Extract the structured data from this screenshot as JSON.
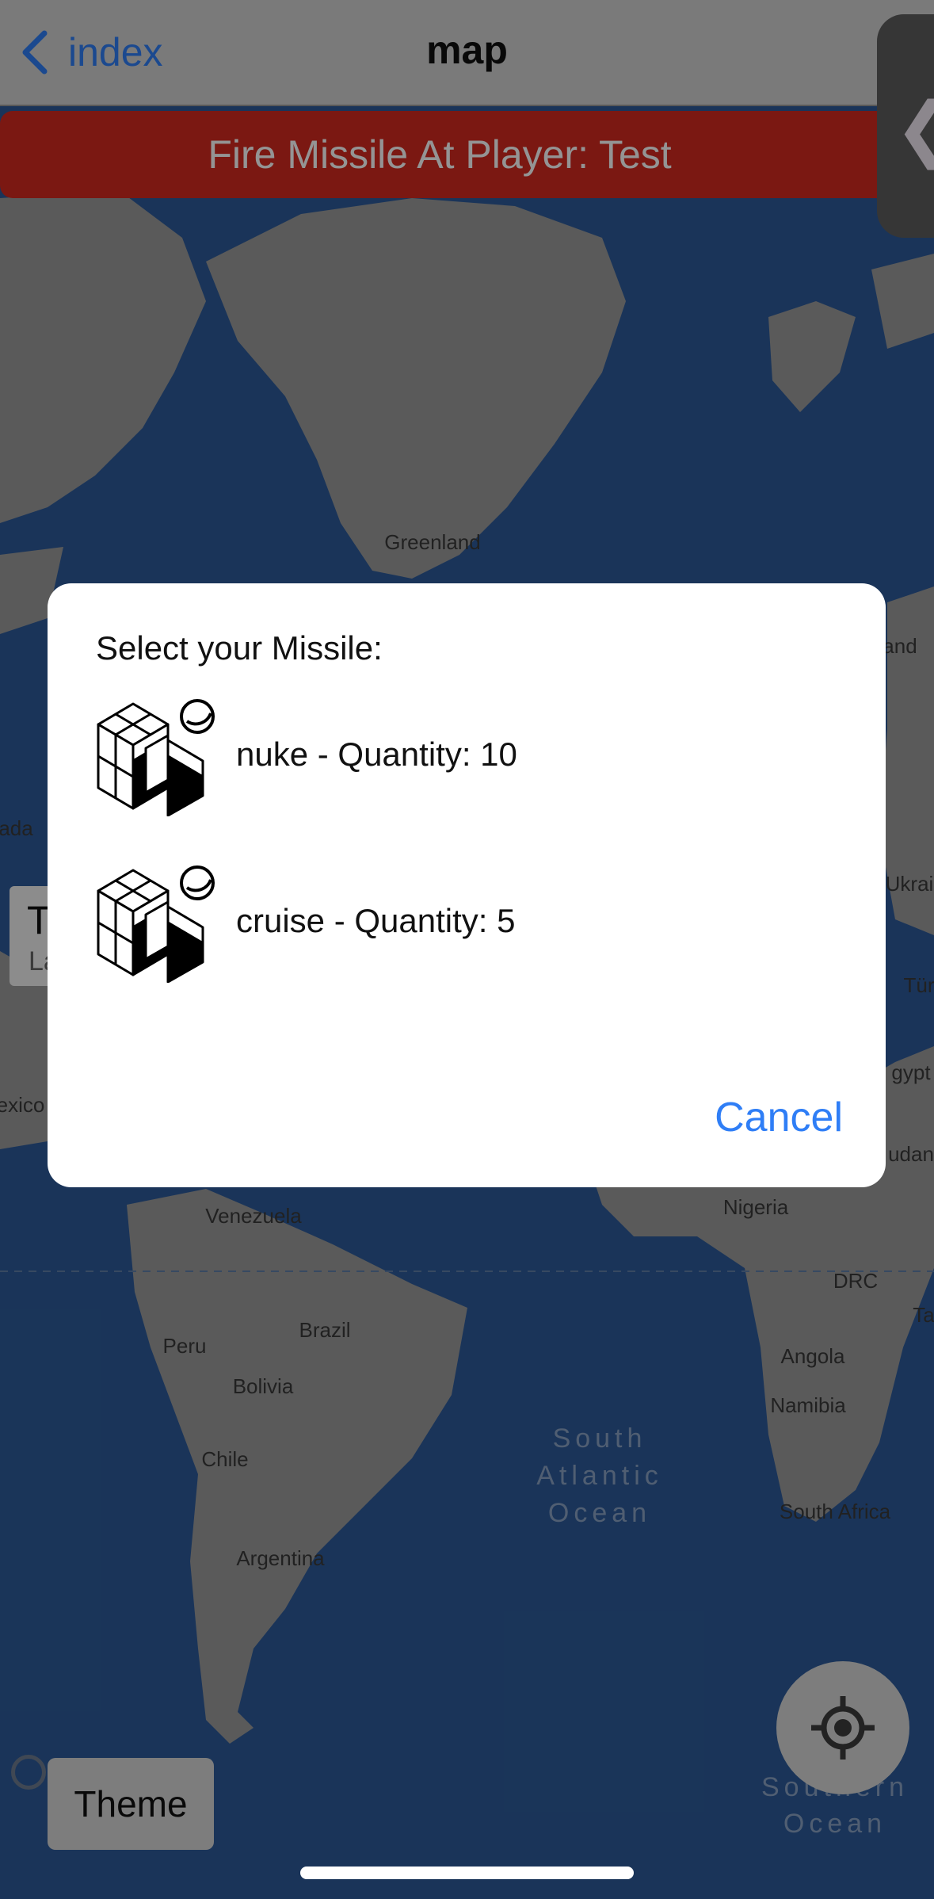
{
  "nav": {
    "back_label": "index",
    "title": "map",
    "side_tab_glyph": "❮"
  },
  "banner": {
    "text": "Fire Missile At Player: Test",
    "color": "#d42a20"
  },
  "map": {
    "ocean_color": "#1a3456",
    "land_color": "#9c9c9c",
    "labels": {
      "greenland": "Greenland",
      "venezuela": "Venezuela",
      "brazil": "Brazil",
      "peru": "Peru",
      "bolivia": "Bolivia",
      "chile": "Chile",
      "argentina": "Argentina",
      "nigeria": "Nigeria",
      "drc": "DRC",
      "angola": "Angola",
      "namibia": "Namibia",
      "south_africa": "South Africa",
      "south_atlantic_1": "South",
      "south_atlantic_2": "Atlantic",
      "south_atlantic_3": "Ocean",
      "southern_1": "Southern",
      "southern_2": "Ocean",
      "canada_fragment": "ada",
      "mexico_fragment": "exico",
      "finland_fragment": "and",
      "ukraine_fragment": "Ukrai",
      "turkey_fragment": "Tür",
      "egypt_fragment": "gypt",
      "sudan_fragment": "udan",
      "tanzania_fragment": "Ta"
    }
  },
  "callout": {
    "title_fragment": "T",
    "subtitle_fragment": "La"
  },
  "dialog": {
    "title": "Select your Missile:",
    "missiles": [
      {
        "label": "nuke - Quantity: 10",
        "icon": "cube-icon"
      },
      {
        "label": "cruise - Quantity: 5",
        "icon": "cube-icon"
      }
    ],
    "cancel_label": "Cancel"
  },
  "theme_button": "Theme",
  "accent": "#2f7ef6"
}
